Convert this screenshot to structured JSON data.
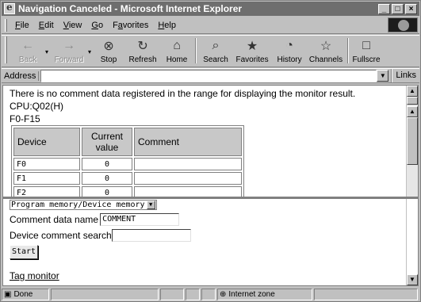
{
  "window": {
    "title": "Navigation Canceled - Microsoft Internet Explorer",
    "controls": [
      "_",
      "□",
      "×"
    ]
  },
  "menu": {
    "items": [
      {
        "key": "F",
        "rest": "ile"
      },
      {
        "key": "E",
        "rest": "dit"
      },
      {
        "key": "V",
        "rest": "iew"
      },
      {
        "key": "G",
        "rest": "o"
      },
      {
        "pre": "F",
        "key": "a",
        "rest": "vorites"
      },
      {
        "key": "H",
        "rest": "elp"
      }
    ]
  },
  "toolbar": {
    "back": "Back",
    "forward": "Forward",
    "stop": "Stop",
    "refresh": "Refresh",
    "home": "Home",
    "search": "Search",
    "favorites": "Favorites",
    "history": "History",
    "channels": "Channels",
    "fullscreen": "Fullscre"
  },
  "address": {
    "label": "Address",
    "value": "",
    "links": "Links"
  },
  "content": {
    "message": "There is no comment data registered in the range for displaying the monitor result.",
    "cpu": "CPU:Q02(H)",
    "range": "F0-F15",
    "table": {
      "headers": [
        "Device",
        "Current value",
        "Comment"
      ],
      "rows": [
        {
          "device": "F0",
          "value": "0",
          "comment": ""
        },
        {
          "device": "F1",
          "value": "0",
          "comment": ""
        },
        {
          "device": "F2",
          "value": "0",
          "comment": ""
        }
      ]
    }
  },
  "form": {
    "memory_select": "Program memory/Device memory",
    "comment_label": "Comment data name",
    "comment_value": "COMMENT",
    "search_label": "Device comment search",
    "search_value": "",
    "start": "Start",
    "tag_link": "Tag monitor"
  },
  "status": {
    "text": "Done",
    "zone": "Internet zone"
  }
}
